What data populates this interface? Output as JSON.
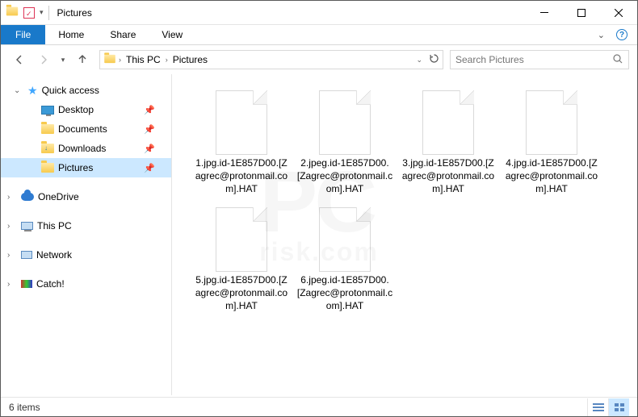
{
  "window": {
    "title": "Pictures"
  },
  "ribbon": {
    "file": "File",
    "tabs": [
      "Home",
      "Share",
      "View"
    ]
  },
  "breadcrumb": {
    "seg1": "This PC",
    "seg2": "Pictures"
  },
  "search": {
    "placeholder": "Search Pictures"
  },
  "sidebar": {
    "quick": "Quick access",
    "items": [
      {
        "label": "Desktop"
      },
      {
        "label": "Documents"
      },
      {
        "label": "Downloads"
      },
      {
        "label": "Pictures"
      }
    ],
    "onedrive": "OneDrive",
    "thispc": "This PC",
    "network": "Network",
    "catch": "Catch!"
  },
  "files": [
    {
      "name": "1.jpg.id-1E857D00.[Zagrec@protonmail.com].HAT"
    },
    {
      "name": "2.jpeg.id-1E857D00.[Zagrec@protonmail.com].HAT"
    },
    {
      "name": "3.jpg.id-1E857D00.[Zagrec@protonmail.com].HAT"
    },
    {
      "name": "4.jpg.id-1E857D00.[Zagrec@protonmail.com].HAT"
    },
    {
      "name": "5.jpg.id-1E857D00.[Zagrec@protonmail.com].HAT"
    },
    {
      "name": "6.jpeg.id-1E857D00.[Zagrec@protonmail.com].HAT"
    }
  ],
  "status": {
    "count": "6 items"
  }
}
